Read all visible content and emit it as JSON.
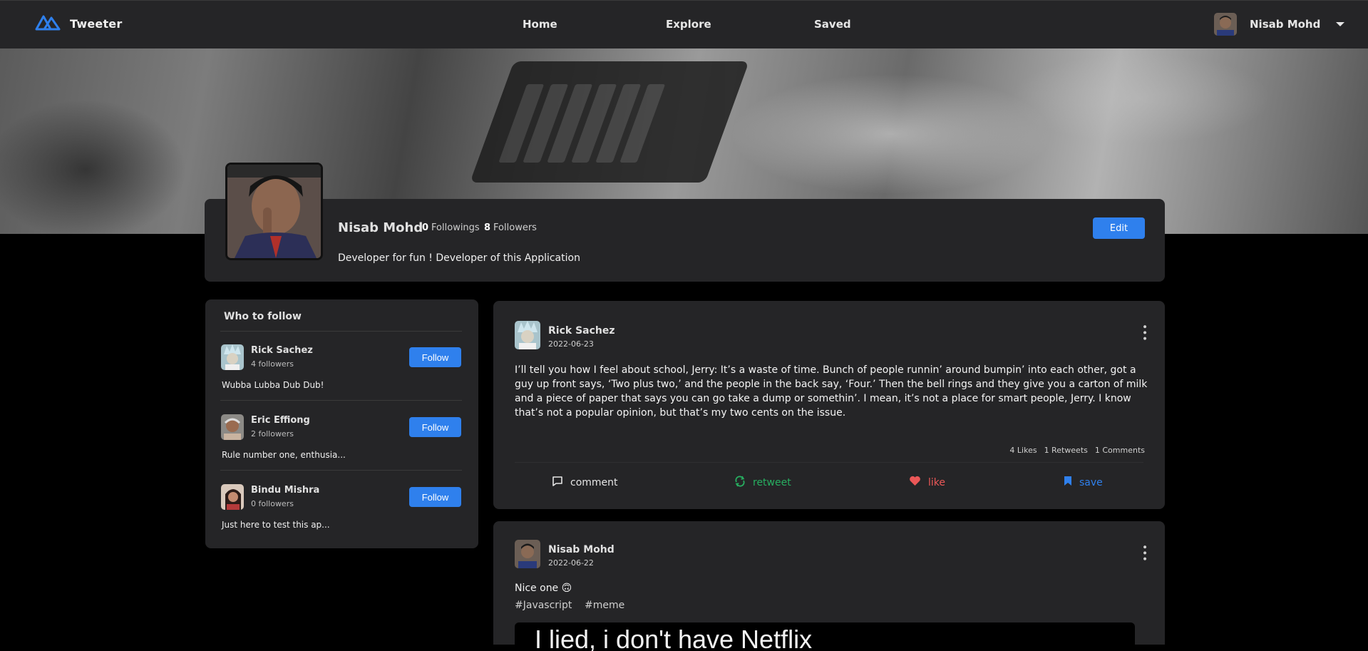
{
  "navbar": {
    "brand": "Tweeter",
    "links": [
      "Home",
      "Explore",
      "Saved"
    ],
    "username": "Nisab Mohd"
  },
  "profile": {
    "name": "Nisab Mohd",
    "followings_count": "0",
    "followings_label": "Followings",
    "followers_count": "8",
    "followers_label": "Followers",
    "bio": "Developer for fun ! Developer of this Application",
    "edit_label": "Edit"
  },
  "who_to_follow": {
    "title": "Who to follow",
    "follow_label": "Follow",
    "items": [
      {
        "name": "Rick Sachez",
        "followers": "4 followers",
        "bio": "Wubba Lubba Dub Dub!"
      },
      {
        "name": "Eric Effiong",
        "followers": "2 followers",
        "bio": "Rule number one, enthusia..."
      },
      {
        "name": "Bindu Mishra",
        "followers": "0 followers",
        "bio": "Just here to test this ap..."
      }
    ]
  },
  "tweets": [
    {
      "author": "Rick Sachez",
      "date": "2022-06-23",
      "text": "I’ll tell you how I feel about school, Jerry: It’s a waste of time. Bunch of people runnin’ around bumpin’ into each other, got a guy up front says, ‘Two plus two,’ and the people in the back say, ‘Four.’ Then the bell rings and they give you a carton of milk and a piece of paper that says you can go take a dump or somethin’. I mean, it’s not a place for smart people, Jerry. I know that’s not a popular opinion, but that’s my two cents on the issue.",
      "likes": "4 Likes",
      "retweets": "1 Retweets",
      "comments": "1 Comments",
      "actions": {
        "comment": "comment",
        "retweet": "retweet",
        "like": "like",
        "save": "save"
      }
    },
    {
      "author": "Nisab Mohd",
      "date": "2022-06-22",
      "text": "Nice one 🙃",
      "tags": [
        "#Javascript",
        "#meme"
      ],
      "image_text": "I lied, i don't have Netflix"
    }
  ],
  "colors": {
    "accent": "#2f80ed",
    "retweet": "#27ae60",
    "like": "#eb5757",
    "save": "#2f80ed",
    "card": "#252527",
    "background": "#000000"
  }
}
